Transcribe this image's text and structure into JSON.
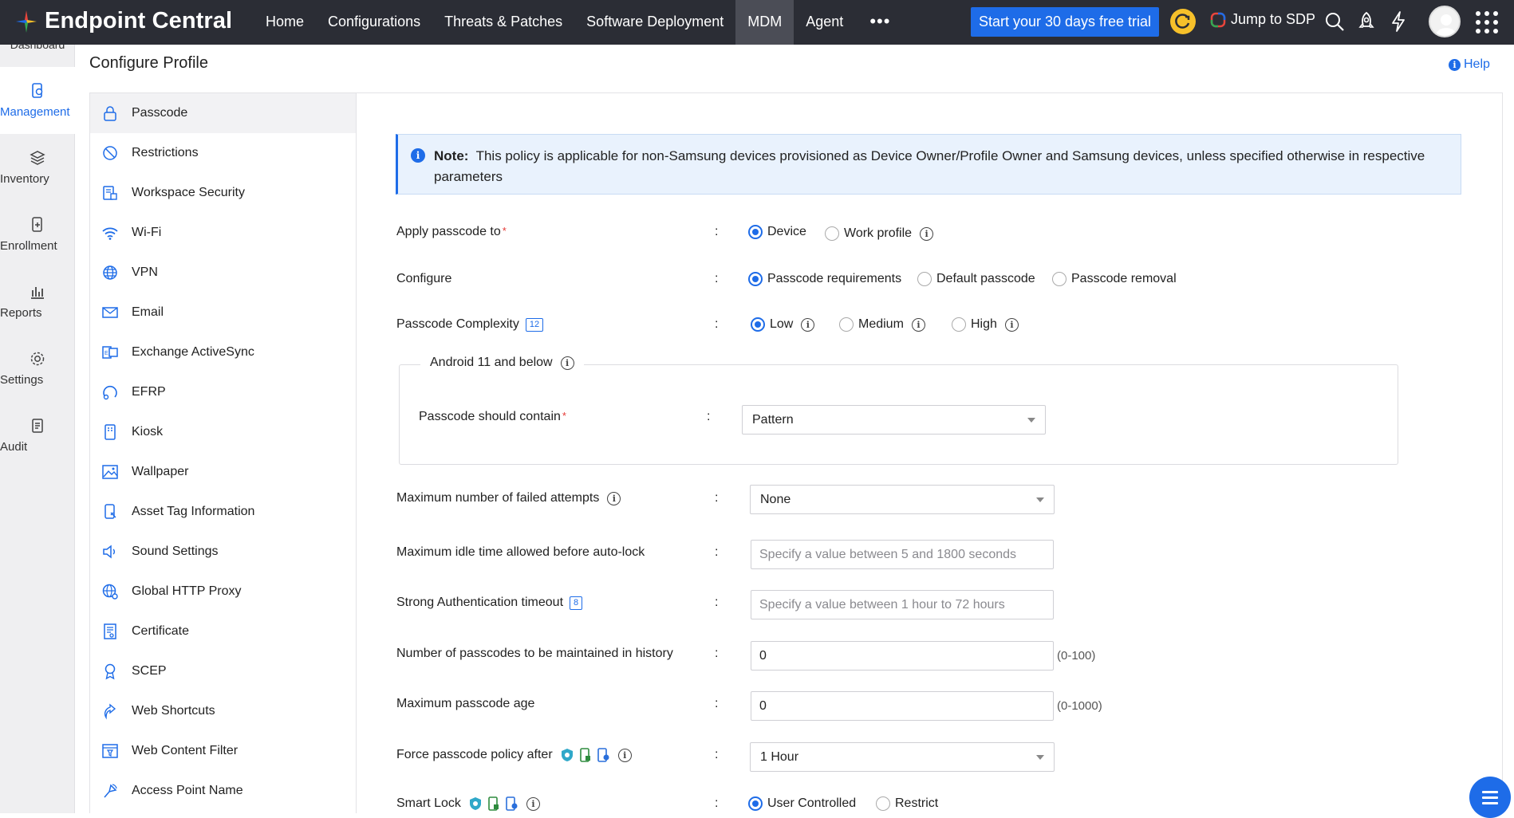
{
  "app": {
    "name": "Endpoint Central"
  },
  "nav": {
    "items": [
      "Home",
      "Configurations",
      "Threats & Patches",
      "Software Deployment",
      "MDM",
      "Agent"
    ],
    "active": "MDM",
    "more": "•••"
  },
  "topbar": {
    "trial_button": "Start your 30 days free trial",
    "jump_label": "Jump to SDP",
    "icons": [
      "sync-icon",
      "search-icon",
      "rocket-icon",
      "lightning-icon",
      "avatar",
      "apps-grid-icon"
    ]
  },
  "rail": {
    "cut_label": "Dashboard",
    "items": [
      {
        "label": "Management",
        "icon": "management-icon",
        "active": true
      },
      {
        "label": "Inventory",
        "icon": "inventory-icon"
      },
      {
        "label": "Enrollment",
        "icon": "enrollment-icon"
      },
      {
        "label": "Reports",
        "icon": "reports-icon"
      },
      {
        "label": "Settings",
        "icon": "settings-icon"
      },
      {
        "label": "Audit",
        "icon": "audit-icon"
      }
    ]
  },
  "page": {
    "title": "Configure Profile",
    "help": "Help"
  },
  "menu": {
    "items": [
      {
        "label": "Passcode",
        "icon": "lock-icon",
        "active": true
      },
      {
        "label": "Restrictions",
        "icon": "restriction-icon"
      },
      {
        "label": "Workspace Security",
        "icon": "workspace-security-icon"
      },
      {
        "label": "Wi-Fi",
        "icon": "wifi-icon"
      },
      {
        "label": "VPN",
        "icon": "globe-icon"
      },
      {
        "label": "Email",
        "icon": "email-icon"
      },
      {
        "label": "Exchange ActiveSync",
        "icon": "exchange-icon"
      },
      {
        "label": "EFRP",
        "icon": "efrp-icon"
      },
      {
        "label": "Kiosk",
        "icon": "kiosk-icon"
      },
      {
        "label": "Wallpaper",
        "icon": "image-icon"
      },
      {
        "label": "Asset Tag Information",
        "icon": "tag-icon"
      },
      {
        "label": "Sound Settings",
        "icon": "speaker-icon"
      },
      {
        "label": "Global HTTP Proxy",
        "icon": "proxy-icon"
      },
      {
        "label": "Certificate",
        "icon": "certificate-icon"
      },
      {
        "label": "SCEP",
        "icon": "scep-icon"
      },
      {
        "label": "Web Shortcuts",
        "icon": "web-shortcut-icon"
      },
      {
        "label": "Web Content Filter",
        "icon": "filter-icon"
      },
      {
        "label": "Access Point Name",
        "icon": "antenna-icon"
      }
    ]
  },
  "note": {
    "prefix": "Note",
    "text": "This policy is applicable for non-Samsung devices provisioned as Device Owner/Profile Owner and Samsung devices, unless specified otherwise in respective parameters"
  },
  "form": {
    "apply_to": {
      "label": "Apply passcode to",
      "options": [
        "Device",
        "Work profile"
      ],
      "selected": "Device"
    },
    "configure": {
      "label": "Configure",
      "options": [
        "Passcode requirements",
        "Default passcode",
        "Passcode removal"
      ],
      "selected": "Passcode requirements"
    },
    "complexity": {
      "label": "Passcode Complexity",
      "badge": "12",
      "options": [
        "Low",
        "Medium",
        "High"
      ],
      "selected": "Low"
    },
    "android_group": {
      "legend": "Android 11 and below",
      "contain_label": "Passcode should contain",
      "contain_value": "Pattern"
    },
    "failed_attempts": {
      "label": "Maximum number of failed attempts",
      "value": "None"
    },
    "idle_time": {
      "label": "Maximum idle time allowed before auto-lock",
      "placeholder": "Specify a value between 5 and 1800 seconds",
      "value": ""
    },
    "strong_auth": {
      "label": "Strong Authentication timeout",
      "badge": "8",
      "placeholder": "Specify a value between 1 hour to 72 hours",
      "value": ""
    },
    "history": {
      "label": "Number of passcodes to be maintained in history",
      "value": "0",
      "range": "(0-100)"
    },
    "max_age": {
      "label": "Maximum passcode age",
      "value": "0",
      "range": "(0-1000)"
    },
    "force_after": {
      "label": "Force passcode policy after",
      "value": "1 Hour"
    },
    "smart_lock": {
      "label": "Smart Lock",
      "options": [
        "User Controlled",
        "Restrict"
      ],
      "selected": "User Controlled"
    },
    "colon": ":"
  },
  "colors": {
    "accent": "#1e6ce8",
    "topbar": "#2b2d35",
    "note_bg": "#e9f2fd"
  }
}
